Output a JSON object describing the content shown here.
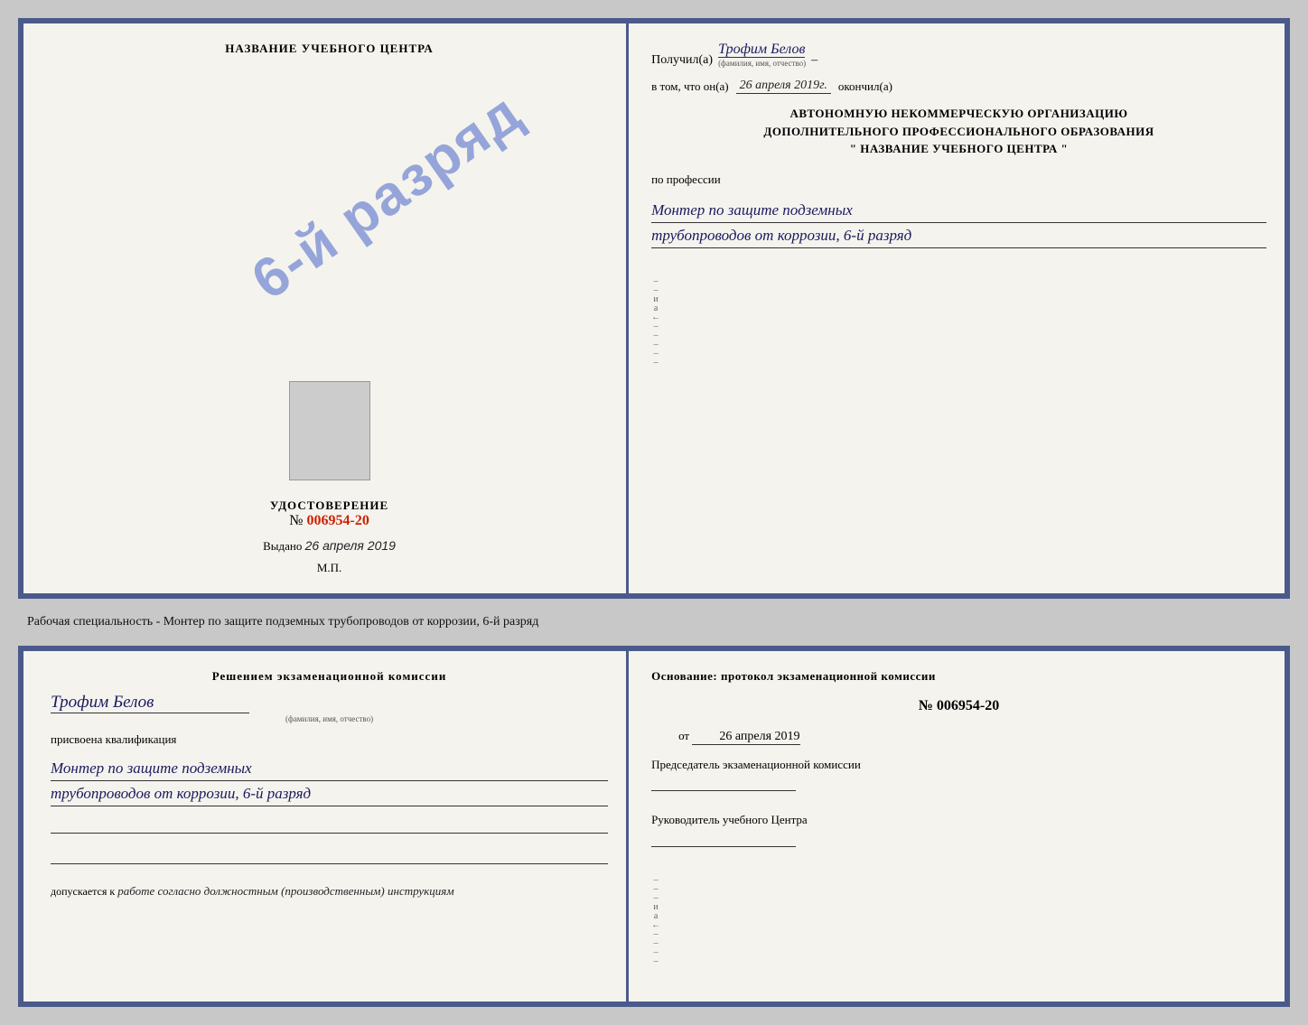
{
  "topCert": {
    "left": {
      "title": "НАЗВАНИЕ УЧЕБНОГО ЦЕНТРА",
      "stamp": "6-й разряд",
      "idLabel": "УДОСТОВЕРЕНИЕ",
      "idPrefix": "№",
      "idNumber": "006954-20",
      "issuedLabel": "Выдано",
      "issuedDate": "26 апреля 2019",
      "mpLabel": "М.П."
    },
    "right": {
      "receivedLabel": "Получил(а)",
      "recipientName": "Трофим Белов",
      "recipientSublabel": "(фамилия, имя, отчество)",
      "dashSymbol": "–",
      "inThatLabel": "в том, что он(а)",
      "completionDate": "26 апреля 2019г.",
      "completedLabel": "окончил(а)",
      "orgLine1": "АВТОНОМНУЮ НЕКОММЕРЧЕСКУЮ ОРГАНИЗАЦИЮ",
      "orgLine2": "ДОПОЛНИТЕЛЬНОГО ПРОФЕССИОНАЛЬНОГО ОБРАЗОВАНИЯ",
      "orgQuote1": "\"",
      "orgCenterName": "НАЗВАНИЕ УЧЕБНОГО ЦЕНТРА",
      "orgQuote2": "\"",
      "professionLabel": "по профессии",
      "professionLine1": "Монтер по защите подземных",
      "professionLine2": "трубопроводов от коррозии, 6-й разряд"
    }
  },
  "specialtyText": "Рабочая специальность - Монтер по защите подземных трубопроводов от коррозии, 6-й разряд",
  "bottomCert": {
    "left": {
      "commissionTitle": "Решением экзаменационной комиссии",
      "personName": "Трофим Белов",
      "personSublabel": "(фамилия, имя, отчество)",
      "assignedLabel": "присвоена квалификация",
      "qualLine1": "Монтер по защите подземных",
      "qualLine2": "трубопроводов от коррозии, 6-й разряд",
      "допускаетсяLabel": "допускается к",
      "допускаетсяText": "работе согласно должностным (производственным) инструкциям"
    },
    "right": {
      "basisLabel": "Основание: протокол экзаменационной комиссии",
      "protocolPrefix": "№",
      "protocolNumber": "006954-20",
      "datePrefix": "от",
      "protocolDate": "26 апреля 2019",
      "chairmanLabel": "Председатель экзаменационной комиссии",
      "centerHeadLabel": "Руководитель учебного Центра"
    }
  },
  "sideChars": {
    "и": "и",
    "а": "а",
    "leftArrow": "←",
    "dashes": [
      "-",
      "-",
      "-",
      "-",
      "-",
      "-",
      "-",
      "-",
      "-",
      "-"
    ]
  }
}
